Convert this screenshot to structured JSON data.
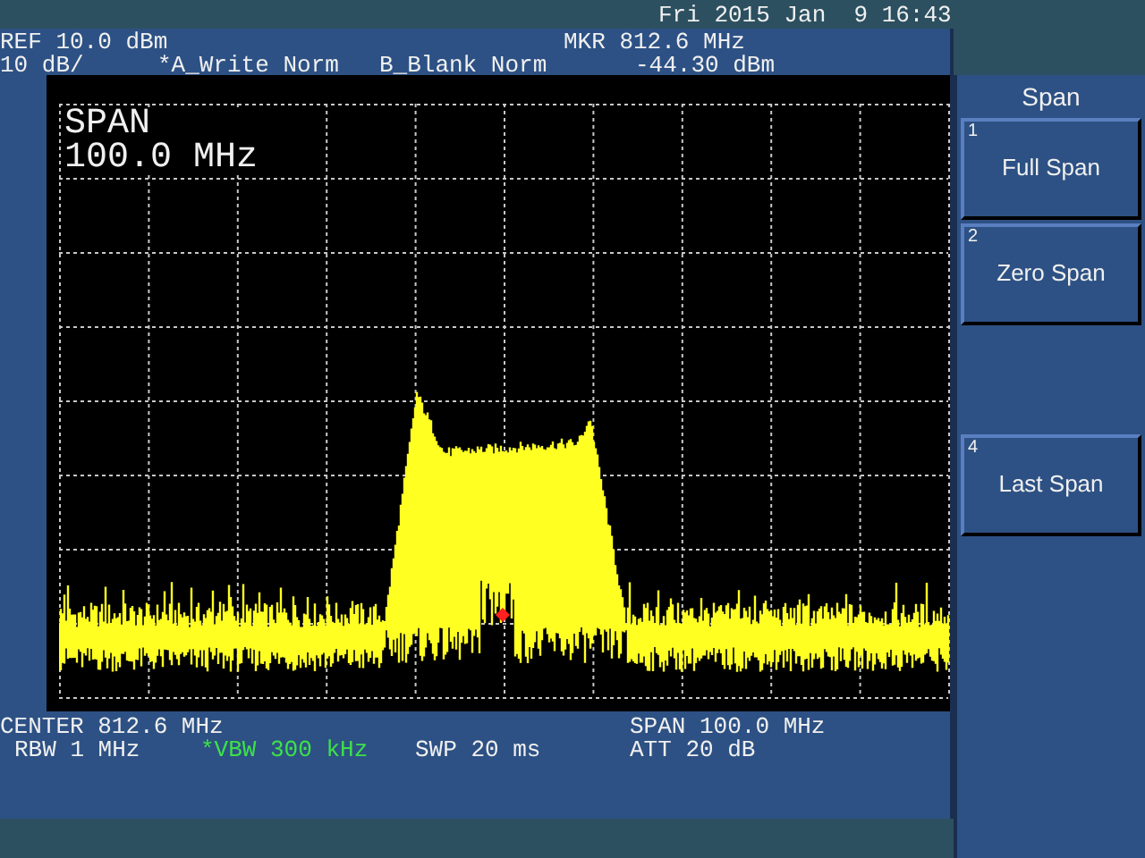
{
  "datetime": "Fri 2015 Jan  9 16:43",
  "header": {
    "ref": "REF 10.0 dBm",
    "scale": "10 dB/",
    "trace_a": "*A_Write Norm",
    "trace_b": "B_Blank Norm",
    "marker_label": "MKR 812.6 MHz",
    "marker_value": "-44.30 dBm"
  },
  "screen_annotation": [
    "SPAN",
    "100.0 MHz"
  ],
  "footer": {
    "center": "CENTER 812.6 MHz",
    "span": "SPAN 100.0 MHz",
    "settings": [
      {
        "text": "RBW 1 MHz",
        "highlighted": false
      },
      {
        "text": "*VBW 300 kHz",
        "highlighted": true
      },
      {
        "text": "SWP 20 ms",
        "highlighted": false
      },
      {
        "text": "ATT 20 dB",
        "highlighted": false
      }
    ]
  },
  "menu": {
    "title": "Span",
    "softkeys": [
      {
        "kind": "key",
        "number": "1",
        "label": "Full Span"
      },
      {
        "kind": "key",
        "number": "2",
        "label": "Zero Span"
      },
      {
        "kind": "empty"
      },
      {
        "kind": "key",
        "number": "4",
        "label": "Last Span"
      }
    ]
  }
}
